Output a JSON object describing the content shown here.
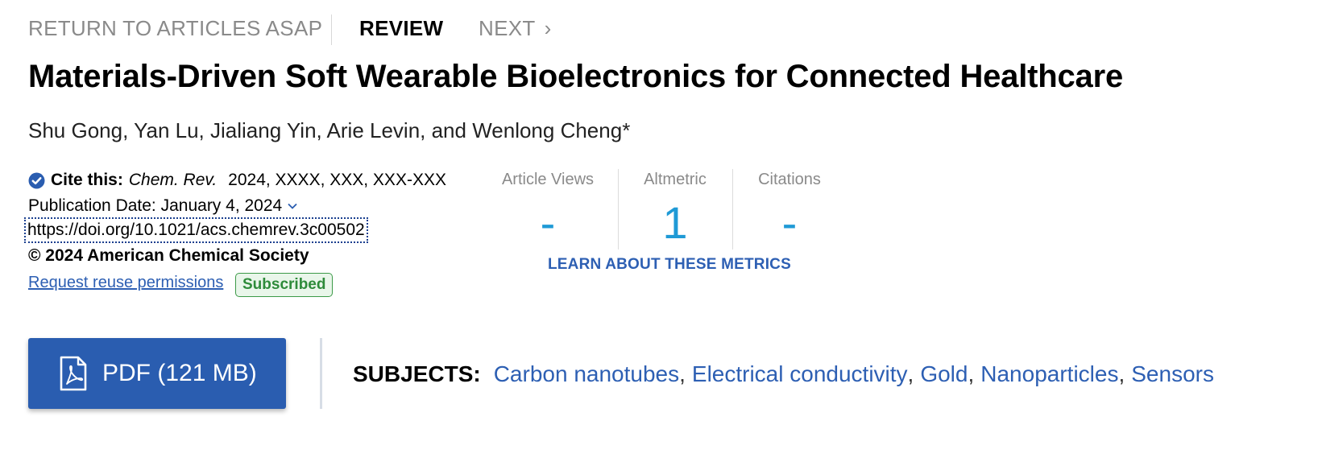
{
  "nav": {
    "return_label": "RETURN TO ARTICLES ASAP",
    "current_label": "REVIEW",
    "next_label": "NEXT",
    "next_chevron": "›"
  },
  "article": {
    "title": "Materials-Driven Soft Wearable Bioelectronics for Connected Healthcare",
    "authors": "Shu Gong, Yan Lu, Jialiang Yin, Arie Levin, and Wenlong Cheng*"
  },
  "citation": {
    "cite_label": "Cite this:",
    "journal": "Chem. Rev.",
    "details": "2024, XXXX, XXX, XXX-XXX",
    "pub_date": "Publication Date: January 4, 2024",
    "doi": "https://doi.org/10.1021/acs.chemrev.3c00502",
    "copyright": "© 2024 American Chemical Society",
    "reuse_label": "Request reuse permissions",
    "status_badge": "Subscribed"
  },
  "metrics": {
    "items": [
      {
        "label": "Article Views",
        "value": "-"
      },
      {
        "label": "Altmetric",
        "value": "1"
      },
      {
        "label": "Citations",
        "value": "-"
      }
    ],
    "learn_label": "LEARN ABOUT THESE METRICS"
  },
  "pdf": {
    "label": "PDF (121 MB)",
    "icon": "pdf-file-icon"
  },
  "subjects": {
    "label": "SUBJECTS:",
    "items": [
      "Carbon nanotubes",
      "Electrical conductivity",
      "Gold",
      "Nanoparticles",
      "Sensors"
    ]
  },
  "colors": {
    "link": "#2d5fb3",
    "metric_value": "#1f9ad6",
    "pdf_button": "#2a5db0",
    "badge_green": "#2e8b3a"
  }
}
